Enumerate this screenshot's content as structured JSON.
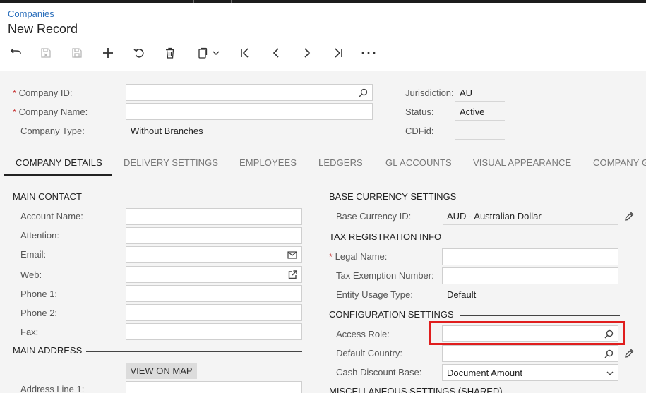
{
  "breadcrumb": "Companies",
  "page_title": "New Record",
  "summary": {
    "company_id_label": "Company ID:",
    "company_name_label": "Company Name:",
    "company_type_label": "Company Type:",
    "company_type_value": "Without Branches",
    "jurisdiction_label": "Jurisdiction:",
    "jurisdiction_value": "AU",
    "status_label": "Status:",
    "status_value": "Active",
    "cdfid_label": "CDFid:"
  },
  "tabs": [
    {
      "label": "Company Details"
    },
    {
      "label": "Delivery Settings"
    },
    {
      "label": "Employees"
    },
    {
      "label": "Ledgers"
    },
    {
      "label": "GL Accounts"
    },
    {
      "label": "Visual Appearance"
    },
    {
      "label": "Company G"
    }
  ],
  "main_contact": {
    "title": "Main Contact",
    "account_name_label": "Account Name:",
    "attention_label": "Attention:",
    "email_label": "Email:",
    "web_label": "Web:",
    "phone1_label": "Phone 1:",
    "phone2_label": "Phone 2:",
    "fax_label": "Fax:"
  },
  "main_address": {
    "title": "Main Address",
    "view_on_map": "View on Map",
    "address_line1_label": "Address Line 1:"
  },
  "base_currency": {
    "title": "Base Currency Settings",
    "base_currency_id_label": "Base Currency ID:",
    "base_currency_id_value": "AUD - Australian Dollar"
  },
  "tax_registration": {
    "title": "Tax Registration Info",
    "legal_name_label": "Legal Name:",
    "tax_exemption_label": "Tax Exemption Number:",
    "entity_usage_label": "Entity Usage Type:",
    "entity_usage_value": "Default"
  },
  "configuration": {
    "title": "Configuration Settings",
    "access_role_label": "Access Role:",
    "default_country_label": "Default Country:",
    "cash_discount_label": "Cash Discount Base:",
    "cash_discount_value": "Document Amount"
  },
  "misc": {
    "title": "Miscellaneous Settings (Shared)"
  },
  "icons": {
    "back": "back-arrow-icon",
    "save_close": "save-close-icon",
    "save": "save-icon",
    "add": "plus-icon",
    "undo": "undo-icon",
    "delete": "trash-icon",
    "clipboard": "clipboard-icon",
    "first": "first-record-icon",
    "prev": "previous-record-icon",
    "next": "next-record-icon",
    "last": "last-record-icon",
    "more": "more-icon",
    "search": "search-icon",
    "email": "envelope-icon",
    "web": "external-link-icon",
    "edit": "pencil-icon",
    "dropdown": "chevron-down-icon"
  },
  "colors": {
    "accent": "#2a6ebb",
    "required": "#c62828",
    "highlight": "#e01e1e"
  }
}
